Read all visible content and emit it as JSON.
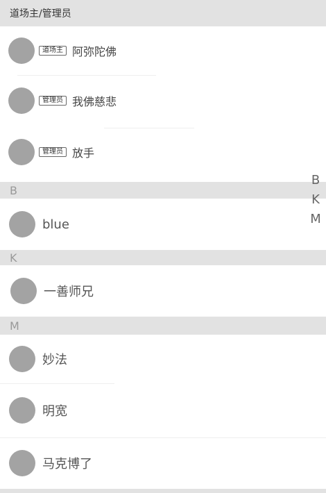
{
  "admin_section": {
    "title": "道场主/管理员",
    "members": [
      {
        "badge": "道场主",
        "name": "阿弥陀佛"
      },
      {
        "badge": "管理员",
        "name": "我佛慈悲"
      },
      {
        "badge": "管理员",
        "name": "放手"
      }
    ]
  },
  "groups": [
    {
      "letter": "B",
      "members": [
        {
          "name": "blue"
        }
      ]
    },
    {
      "letter": "K",
      "members": [
        {
          "name": "一善师兄"
        }
      ]
    },
    {
      "letter": "M",
      "members": [
        {
          "name": "妙法"
        },
        {
          "name": "明宽"
        },
        {
          "name": "马克博了"
        }
      ]
    }
  ],
  "index_bar": [
    "B",
    "K",
    "M"
  ],
  "colors": {
    "section_bg": "#e2e2e2",
    "avatar": "#a3a3a3",
    "letter_text": "#999999"
  }
}
